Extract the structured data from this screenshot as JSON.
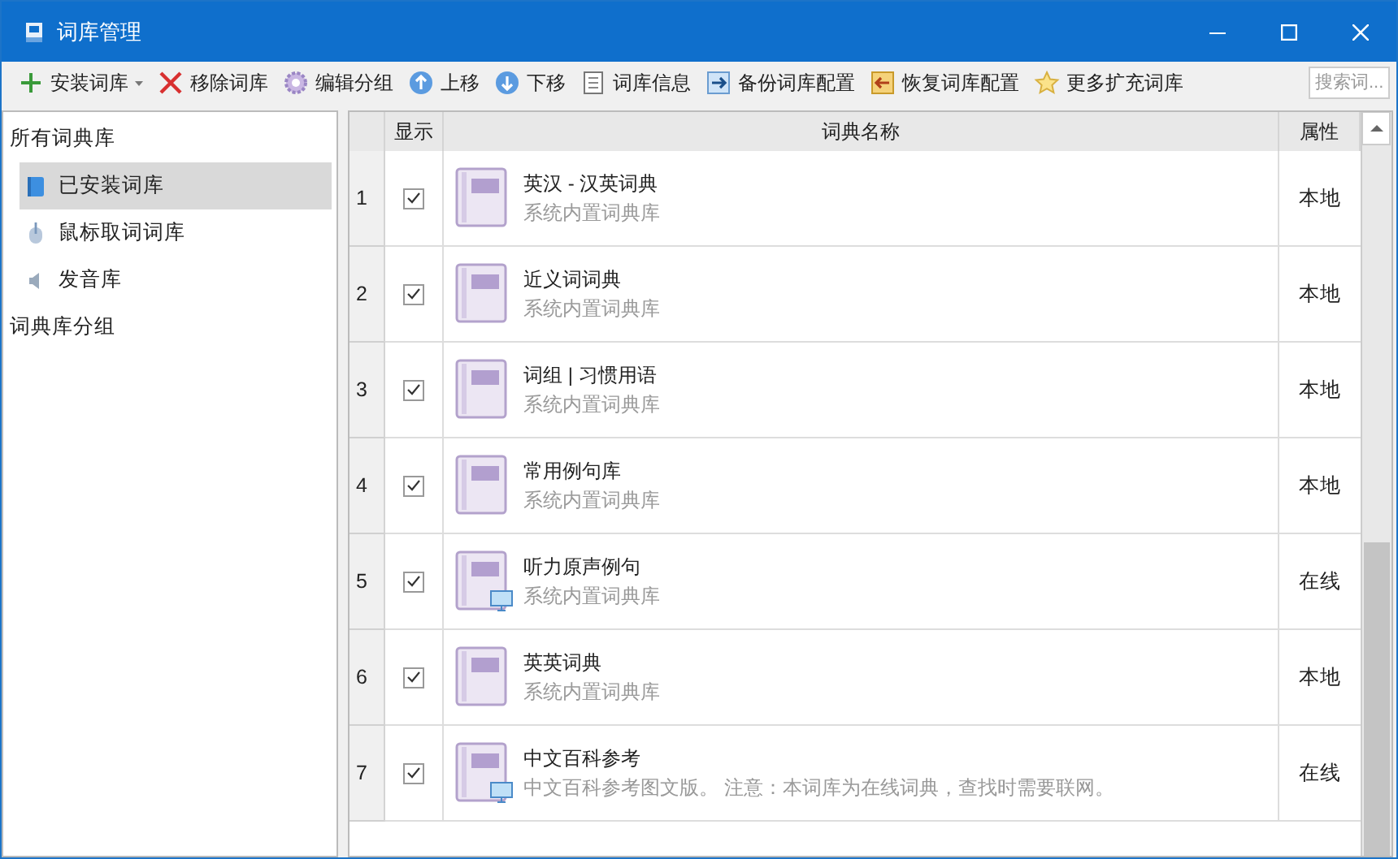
{
  "window": {
    "title": "词库管理"
  },
  "toolbar": [
    {
      "kind": "plus",
      "label": "安装词库",
      "dropdown": true
    },
    {
      "kind": "cross",
      "label": "移除词库",
      "dropdown": false
    },
    {
      "kind": "gear",
      "label": "编辑分组",
      "dropdown": false
    },
    {
      "kind": "up",
      "label": "上移",
      "dropdown": false
    },
    {
      "kind": "down",
      "label": "下移",
      "dropdown": false
    },
    {
      "kind": "document",
      "label": "词库信息",
      "dropdown": false
    },
    {
      "kind": "backup",
      "label": "备份词库配置",
      "dropdown": false
    },
    {
      "kind": "restore",
      "label": "恢复词库配置",
      "dropdown": false
    },
    {
      "kind": "star",
      "label": "更多扩充词库",
      "dropdown": false
    }
  ],
  "search": {
    "placeholder": "搜索词..."
  },
  "sidebar": {
    "items": [
      {
        "label": "所有词典库",
        "selected": false,
        "children": [
          {
            "label": "已安装词库",
            "kind": "book",
            "selected": true
          },
          {
            "label": "鼠标取词词库",
            "kind": "mouse",
            "selected": false
          },
          {
            "label": "发音库",
            "kind": "speaker",
            "selected": false
          }
        ]
      },
      {
        "label": "词典库分组",
        "selected": false
      }
    ]
  },
  "table": {
    "columns": [
      "显示",
      "词典名称",
      "属性"
    ],
    "rows": [
      {
        "number": "1",
        "checked": true,
        "name": "英汉 - 汉英词典",
        "description": "系统内置词典库",
        "online": false,
        "attribute": "本地"
      },
      {
        "number": "2",
        "checked": true,
        "name": "近义词词典",
        "description": "系统内置词典库",
        "online": false,
        "attribute": "本地"
      },
      {
        "number": "3",
        "checked": true,
        "name": "词组 | 习惯用语",
        "description": "系统内置词典库",
        "online": false,
        "attribute": "本地"
      },
      {
        "number": "4",
        "checked": true,
        "name": "常用例句库",
        "description": "系统内置词典库",
        "online": false,
        "attribute": "本地"
      },
      {
        "number": "5",
        "checked": true,
        "name": "听力原声例句",
        "description": "系统内置词典库",
        "online": true,
        "attribute": "在线"
      },
      {
        "number": "6",
        "checked": true,
        "name": "英英词典",
        "description": "系统内置词典库",
        "online": false,
        "attribute": "本地"
      },
      {
        "number": "7",
        "checked": true,
        "name": "中文百科参考",
        "description": "中文百科参考图文版。 注意：本词库为在线词典，查找时需要联网。",
        "online": true,
        "attribute": "在线"
      }
    ]
  }
}
